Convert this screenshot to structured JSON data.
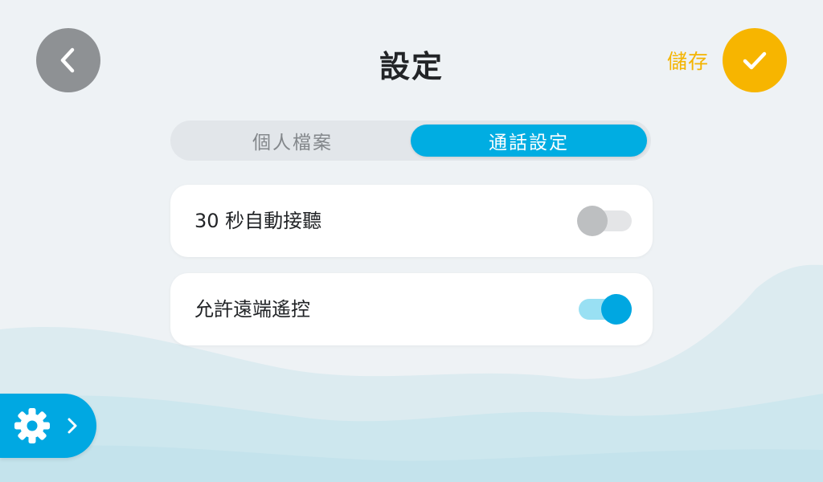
{
  "header": {
    "title": "設定",
    "back_icon": "chevron-left-icon",
    "save_label": "儲存",
    "save_icon": "checkmark-icon"
  },
  "tabs": [
    {
      "label": "個人檔案",
      "active": false
    },
    {
      "label": "通話設定",
      "active": true
    }
  ],
  "settings": [
    {
      "label": "30 秒自動接聽",
      "enabled": false
    },
    {
      "label": "允許遠端遙控",
      "enabled": true
    }
  ],
  "settings_fab": {
    "icon": "gear-icon",
    "chevron_icon": "chevron-right-icon"
  },
  "colors": {
    "accent": "#00a8e2",
    "save": "#f7b500",
    "back_button": "#8e9194",
    "background": "#eef2f5"
  }
}
